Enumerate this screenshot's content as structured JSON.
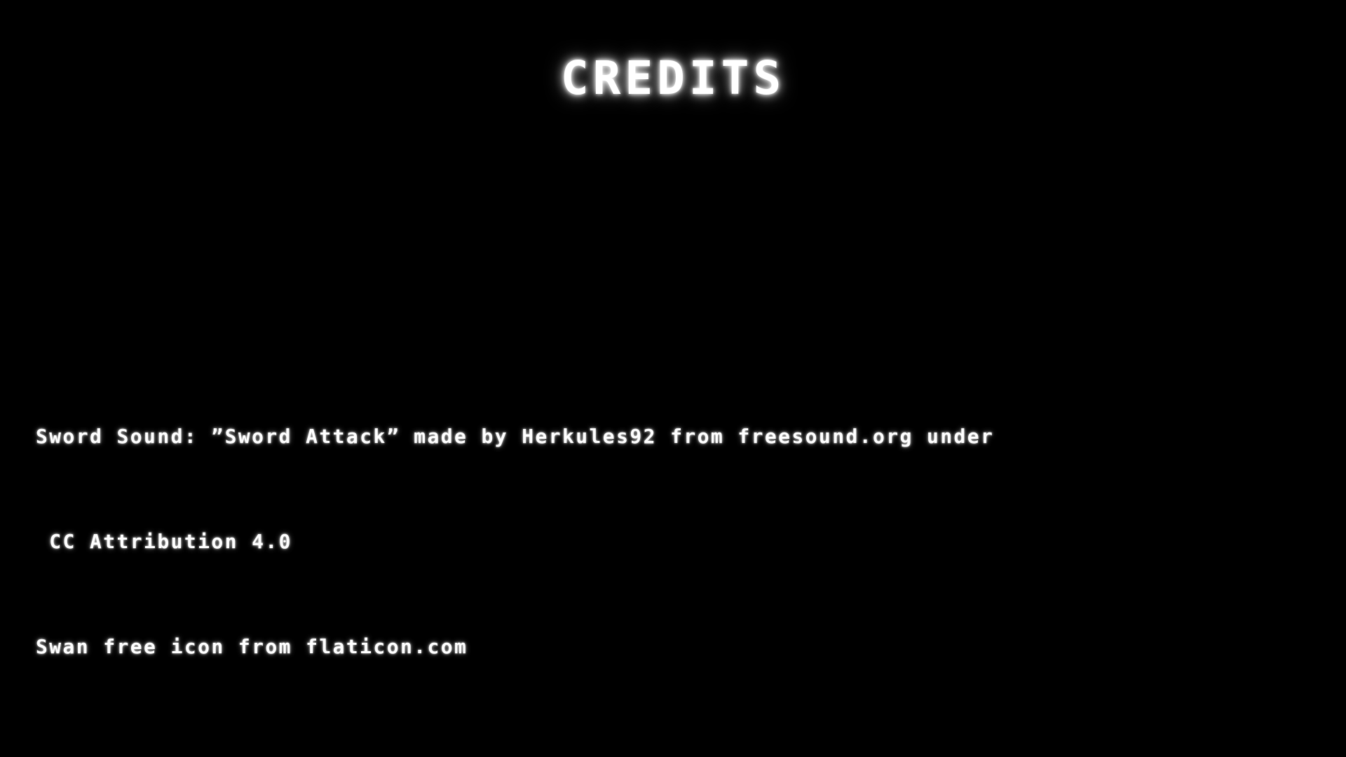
{
  "screen": {
    "title": "CREDITS",
    "background_color": "#000000",
    "text_color": "#ffffff"
  },
  "credits": [
    {
      "line1": "Sword Sound: ”Sword Attack” made by Herkules92 from freesound.org under",
      "line2": " CC Attribution 4.0"
    },
    {
      "line1": "Swan free icon from flaticon.com"
    }
  ]
}
